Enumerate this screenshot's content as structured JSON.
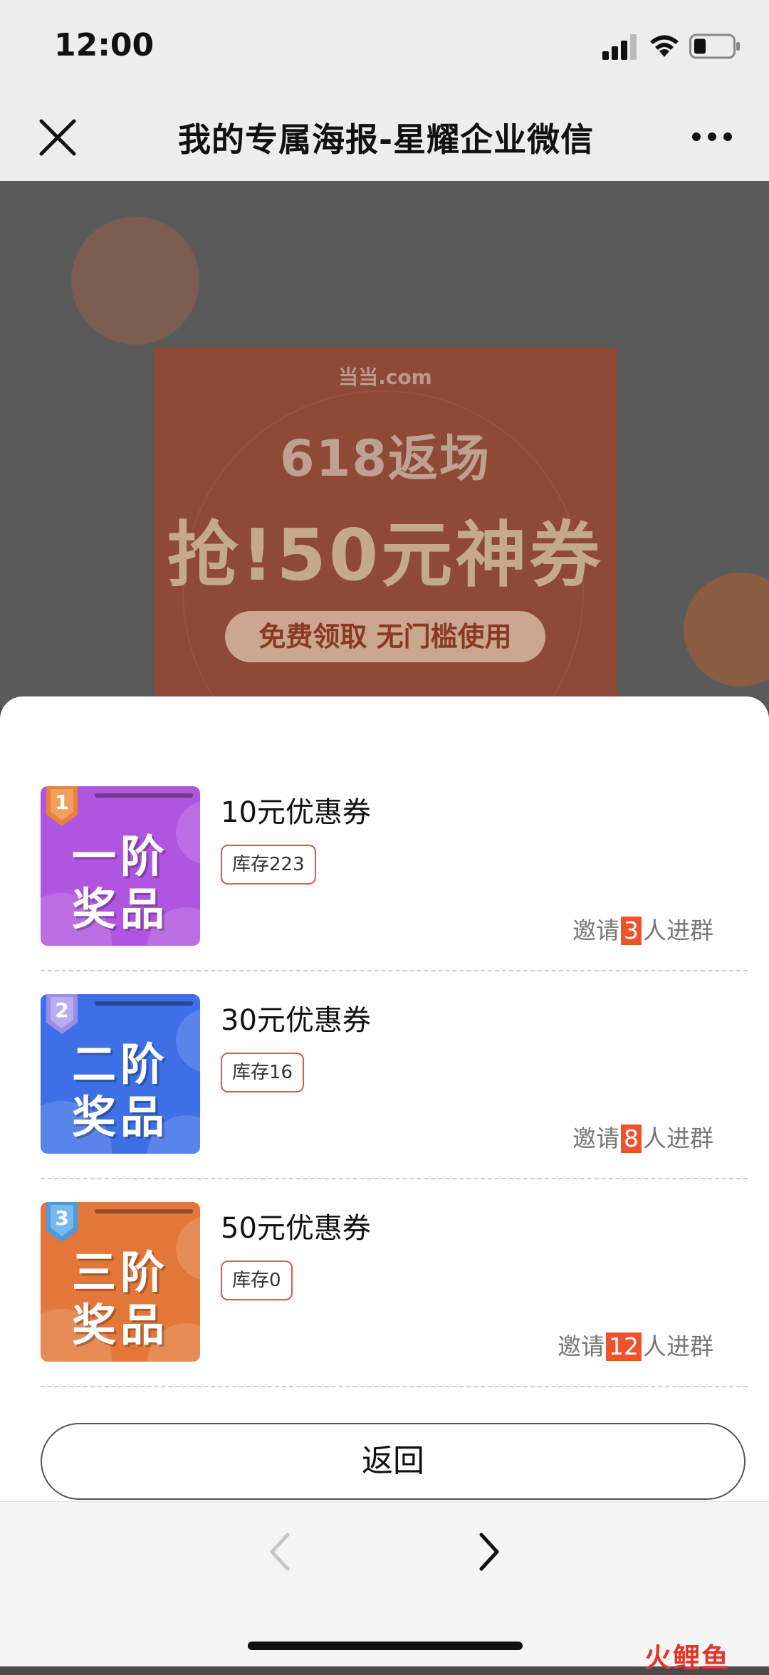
{
  "status_bar": {
    "time": "12:00"
  },
  "nav": {
    "title": "我的专属海报-星耀企业微信"
  },
  "poster": {
    "logo": "当当.com",
    "line1": "618返场",
    "line2": "抢!50元神券",
    "button": "免费领取  无门槛使用"
  },
  "rewards": [
    {
      "badge_num": "1",
      "line1": "一阶",
      "line2": "奖品",
      "name": "10元优惠券",
      "stock": "库存223",
      "invite_prefix": "邀请",
      "invite_count": "3",
      "invite_suffix": "人进群",
      "color": "#b055e0"
    },
    {
      "badge_num": "2",
      "line1": "二阶",
      "line2": "奖品",
      "name": "30元优惠券",
      "stock": "库存16",
      "invite_prefix": "邀请",
      "invite_count": "8",
      "invite_suffix": "人进群",
      "color": "#3d6fe6"
    },
    {
      "badge_num": "3",
      "line1": "三阶",
      "line2": "奖品",
      "name": "50元优惠券",
      "stock": "库存0",
      "invite_prefix": "邀请",
      "invite_count": "12",
      "invite_suffix": "人进群",
      "color": "#e3773a"
    }
  ],
  "back_button": "返回",
  "watermark": "火鲤鱼",
  "colors": {
    "accent": "#f0522b",
    "stock_border": "#e8534a"
  }
}
